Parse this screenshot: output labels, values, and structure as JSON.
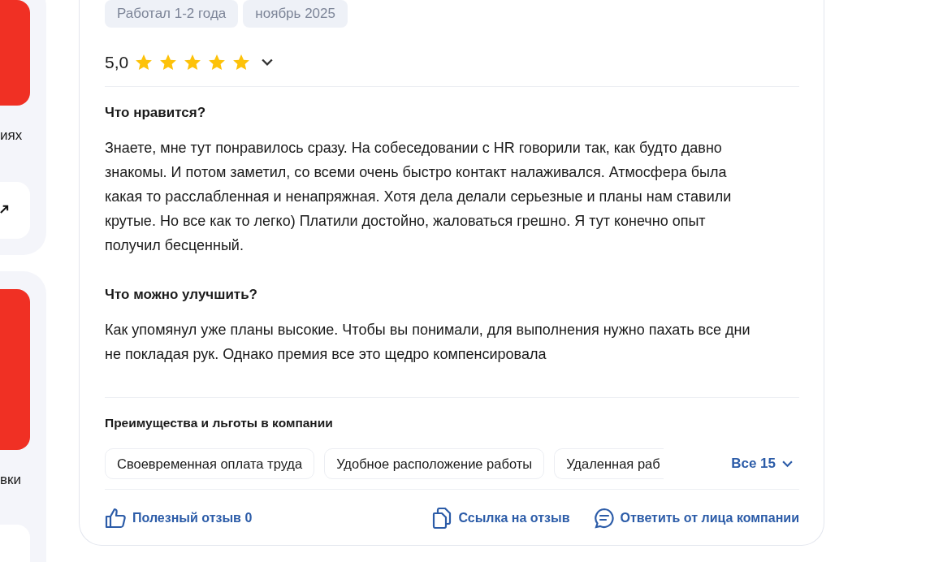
{
  "sidebar": {
    "panels": [
      {
        "caption": "иях"
      },
      {
        "caption": "вки"
      }
    ]
  },
  "review": {
    "tags": [
      "Работал 1-2 года",
      "ноябрь 2025"
    ],
    "rating": {
      "value": "5,0",
      "stars": 5,
      "expanded": false
    },
    "sections": [
      {
        "title": "Что нравится?",
        "text": "Знаете, мне тут понравилось сразу. На собеседовании с HR говорили так, как будто давно знакомы. И потом заметил, со всеми очень быстро контакт налаживался. Атмосфера была какая то расслабленная и ненапряжная. Хотя дела делали серьезные и планы нам ставили крутые. Но все как то легко) Платили достойно, жаловаться грешно. Я тут конечно опыт получил бесценный."
      },
      {
        "title": "Что можно улучшить?",
        "text": "Как упомянул уже планы высокие. Чтобы вы понимали, для выполнения нужно пахать все дни не покладая рук. Однако премия все это щедро компенсировала"
      }
    ],
    "benefits": {
      "title": "Преимущества и льготы в компании",
      "items": [
        "Своевременная оплата труда",
        "Удобное расположение работы",
        "Удаленная раб"
      ],
      "more": "Все 15"
    },
    "actions": [
      {
        "kind": "like",
        "label": "Полезный отзыв 0"
      },
      {
        "kind": "link",
        "label": "Ссылка на отзыв"
      },
      {
        "kind": "reply",
        "label": "Ответить от лица компании"
      }
    ]
  }
}
